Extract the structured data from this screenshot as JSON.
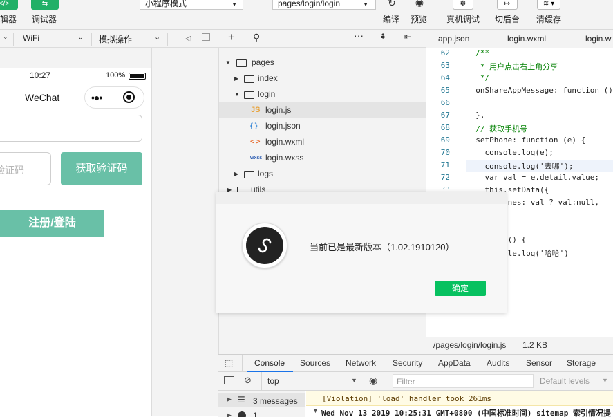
{
  "toolbar": {
    "editor_label": "编辑器",
    "debugger_label": "调试器",
    "mode_select": "小程序模式",
    "page_select": "pages/login/login",
    "compile": "编译",
    "preview": "预览",
    "remote_debug": "真机调试",
    "background": "切后台",
    "clear_cache": "清缓存"
  },
  "subbar": {
    "network": "WiFi",
    "sim_op": "模拟操作"
  },
  "phone": {
    "time": "10:27",
    "battery": "100%",
    "nav_title": "WeChat",
    "code_placeholder": "验证码",
    "get_code_button": "获取验证码",
    "register_button": "注册/登陆"
  },
  "tree": {
    "items": [
      {
        "label": "pages",
        "icon": "folder-open-icon",
        "arrow": "▼"
      },
      {
        "label": "index",
        "icon": "folder-icon",
        "arrow": "▶"
      },
      {
        "label": "login",
        "icon": "folder-open-icon",
        "arrow": "▼"
      },
      {
        "label": "login.js",
        "icon": "js-file-icon",
        "badge": "JS"
      },
      {
        "label": "login.json",
        "icon": "json-file-icon",
        "badge": "{ }"
      },
      {
        "label": "login.wxml",
        "icon": "wxml-file-icon",
        "badge": "< >"
      },
      {
        "label": "login.wxss",
        "icon": "wxss-file-icon",
        "badge": "wxss"
      },
      {
        "label": "logs",
        "icon": "folder-icon",
        "arrow": "▶"
      },
      {
        "label": "utils",
        "icon": "folder-icon",
        "arrow": "▶"
      }
    ]
  },
  "editor": {
    "tabs": [
      "app.json",
      "login.wxml",
      "login.w"
    ],
    "line_numbers": [
      "62",
      "63",
      "64",
      "65",
      "66",
      "67",
      "68",
      "69",
      "70",
      "71",
      "72",
      "73"
    ],
    "lines": [
      "  /**",
      "   * 用户点击右上角分享",
      "   */",
      "  onShareAppMessage: function ()",
      "",
      "  },",
      "  // 获取手机号",
      "  setPhone: function (e) {",
      "    console.log(e);",
      "    console.log('去哪');",
      "    var val = e.detail.value;",
      "    this.setData({",
      "      phones: val ? val:null,",
      "",
      "",
      "  status () {",
      "    console.log('哈哈')"
    ],
    "status_path": "/pages/login/login.js",
    "status_size": "1.2 KB"
  },
  "dialog": {
    "message": "当前已是最新版本（1.02.1910120）",
    "confirm": "确定"
  },
  "devtools": {
    "tabs": [
      "Console",
      "Sources",
      "Network",
      "Security",
      "AppData",
      "Audits",
      "Sensor",
      "Storage"
    ],
    "context": "top",
    "filter_placeholder": "Filter",
    "levels": "Default levels",
    "messages": "3 messages",
    "count_1": "1",
    "log_1": "[Violation] 'load' handler took 261ms",
    "log_2": "Wed Nov 13 2019 10:25:31 GMT+0800 (中国标准时间) sitemap 索引情况提"
  }
}
